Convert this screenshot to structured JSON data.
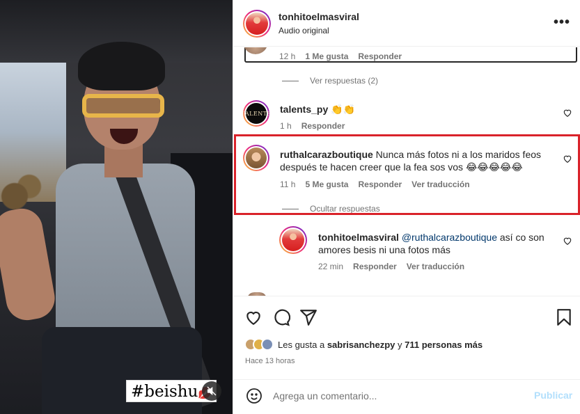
{
  "media": {
    "hashtag": "#beishu",
    "hashtag_emoji": "💋",
    "mute_icon": "speaker-muted-icon"
  },
  "header": {
    "username": "tonhitoelmasviral",
    "subtitle": "Audio original",
    "more_label": "•••"
  },
  "comments": {
    "previous": {
      "time": "12 h",
      "likes": "1 Me gusta",
      "reply": "Responder"
    },
    "view_replies": "Ver respuestas (2)",
    "talents": {
      "username": "talents_py",
      "text": "👏👏",
      "time": "1 h",
      "reply": "Responder",
      "avatar_text": "TALENTS"
    },
    "ruth": {
      "username": "ruthalcarazboutique",
      "text": " Nunca más fotos ni a los maridos feos después te hacen creer que la fea sos vos 😂😂😂😂😂",
      "time": "11 h",
      "likes": "5 Me gusta",
      "reply": "Responder",
      "translate": "Ver traducción"
    },
    "hide_replies": "Ocultar respuestas",
    "reply1": {
      "username": "tonhitoelmasviral",
      "mention": "@ruthalcarazboutique",
      "text": " así co son amores besis ni una fotos más",
      "time": "22 min",
      "reply": "Responder",
      "translate": "Ver traducción"
    }
  },
  "actions": {
    "likes_prefix": "Les gusta a ",
    "likes_user": "sabrisanchezpy",
    "likes_and": " y ",
    "likes_count": "711 personas más",
    "time_ago": "Hace 13 horas"
  },
  "add_comment": {
    "placeholder": "Agrega un comentario...",
    "publish": "Publicar"
  },
  "colors": {
    "highlight": "#d9222a",
    "mention": "#00376b",
    "publish_disabled": "#b2dffc"
  }
}
